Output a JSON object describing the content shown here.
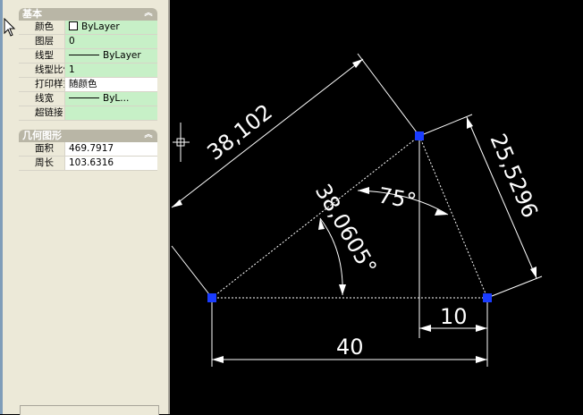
{
  "panel": {
    "basic": {
      "title": "基本",
      "rows": [
        {
          "name": "颜色",
          "value": "ByLayer"
        },
        {
          "name": "图层",
          "value": "0"
        },
        {
          "name": "线型",
          "value": "ByLayer"
        },
        {
          "name": "线型比例",
          "value": "1"
        },
        {
          "name": "打印样式",
          "value": "随颜色"
        },
        {
          "name": "线宽",
          "value": "ByL..."
        },
        {
          "name": "超链接",
          "value": ""
        }
      ]
    },
    "geometry": {
      "title": "几何图形",
      "rows": [
        {
          "name": "面积",
          "value": "469.7917"
        },
        {
          "name": "周长",
          "value": "103.6316"
        }
      ]
    }
  },
  "drawing": {
    "dimensions": {
      "top_left": "38,102",
      "right": "25,5296",
      "diagonal": "38,0605°",
      "angle": "75°",
      "short_bottom": "10",
      "bottom": "40"
    },
    "colors": {
      "background": "#000000",
      "lines": "#ffffff",
      "grips": "#1a3cff"
    }
  }
}
